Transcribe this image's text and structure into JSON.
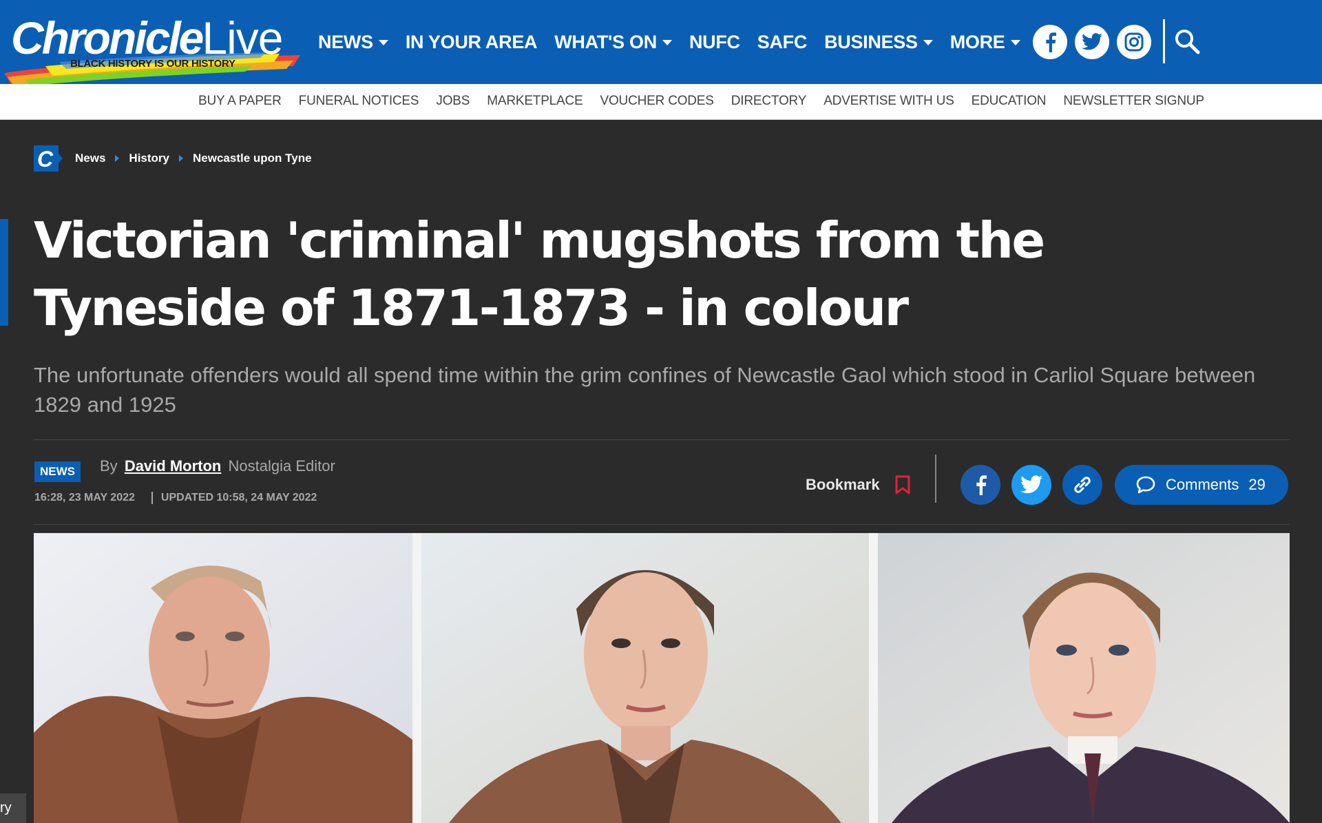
{
  "header": {
    "logo_main": "Chronicle",
    "logo_live": "Live",
    "logo_tagline": "BLACK HISTORY IS OUR HISTORY",
    "nav": [
      {
        "label": "NEWS",
        "dropdown": true
      },
      {
        "label": "IN YOUR AREA",
        "dropdown": false
      },
      {
        "label": "WHAT'S ON",
        "dropdown": true
      },
      {
        "label": "NUFC",
        "dropdown": false
      },
      {
        "label": "SAFC",
        "dropdown": false
      },
      {
        "label": "BUSINESS",
        "dropdown": true
      },
      {
        "label": "MORE",
        "dropdown": true
      }
    ],
    "social_icons": [
      "facebook-icon",
      "twitter-icon",
      "instagram-icon"
    ],
    "search_icon": "search-icon",
    "brand_color": "#0a5fb4"
  },
  "subnav": {
    "items": [
      "BUY A PAPER",
      "FUNERAL NOTICES",
      "JOBS",
      "MARKETPLACE",
      "VOUCHER CODES",
      "DIRECTORY",
      "ADVERTISE WITH US",
      "EDUCATION",
      "NEWSLETTER SIGNUP"
    ]
  },
  "breadcrumb": {
    "items": [
      "News",
      "History",
      "Newcastle upon Tyne"
    ]
  },
  "article": {
    "headline": "Victorian 'criminal' mugshots from the Tyneside of 1871-1873 - in colour",
    "standfirst": "The unfortunate offenders would all spend time within the grim confines of Newcastle Gaol which stood in Carliol Square between 1829 and 1925",
    "section_badge": "NEWS",
    "byline_prefix": "By",
    "author": "David Morton",
    "author_role": "Nostalgia Editor",
    "published": "16:28, 23 MAY 2022",
    "updated": "UPDATED 10:58, 24 MAY 2022"
  },
  "actions": {
    "bookmark_label": "Bookmark",
    "share_icons": [
      "facebook-share-icon",
      "twitter-share-icon",
      "copy-link-icon"
    ],
    "comments_label": "Comments",
    "comments_count": "29"
  },
  "side_tab": "ry"
}
